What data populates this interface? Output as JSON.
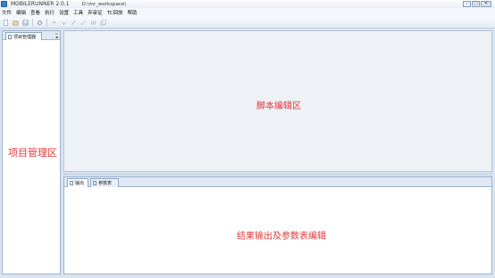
{
  "window": {
    "app_name": "MOBILERUNNER 2.0.1",
    "workspace_path": "D:\\mr_workspace\\"
  },
  "menu": {
    "items": [
      {
        "label": "文件"
      },
      {
        "label": "编辑"
      },
      {
        "label": "查看"
      },
      {
        "label": "执行"
      },
      {
        "label": "设置"
      },
      {
        "label": "工具"
      },
      {
        "label": "弃审证"
      },
      {
        "label": "TC回放"
      },
      {
        "label": "帮助"
      }
    ]
  },
  "left_panel": {
    "tab_label": "项目管理器",
    "annotation": "项目管理区"
  },
  "editor": {
    "annotation": "脚本编辑区"
  },
  "bottom_panel": {
    "tabs": [
      {
        "label": "输出"
      },
      {
        "label": "参数表"
      }
    ],
    "annotation": "结果输出及参数表编辑"
  },
  "colors": {
    "annotation_red": "#e03a3a",
    "panel_border": "#9fb3cc",
    "editor_bg": "#eef1f5"
  }
}
